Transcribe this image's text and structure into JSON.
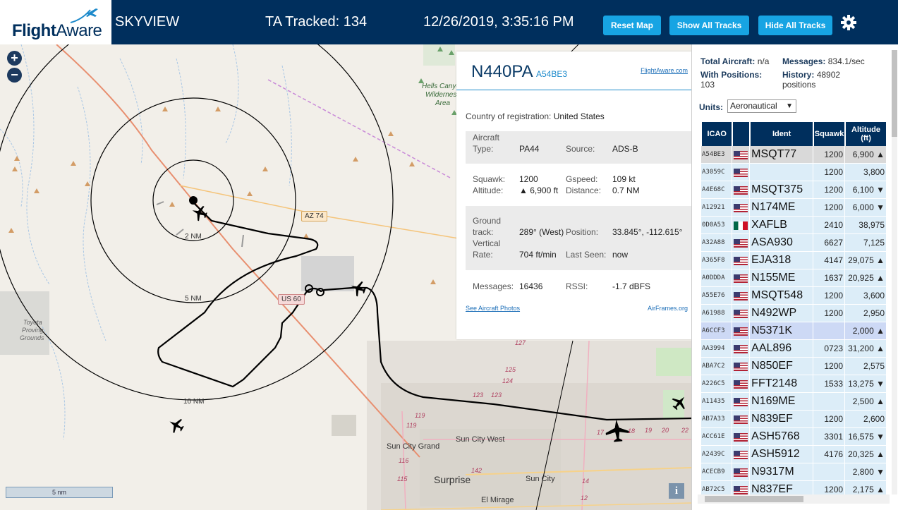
{
  "header": {
    "logo_text_a": "Flight",
    "logo_text_b": "Aware",
    "site_name": "SKYVIEW",
    "ta_tracked": "TA Tracked: 134",
    "clock": "12/26/2019, 3:35:16 PM",
    "buttons": {
      "reset_map": "Reset Map",
      "show_all": "Show All Tracks",
      "hide_all": "Hide All Tracks"
    },
    "settings_icon": "gear-icon",
    "bg_color": "#002f5d",
    "button_color": "#17a4e3"
  },
  "map": {
    "zoom_in": "+",
    "zoom_out": "−",
    "scale_label": "5 nm",
    "info": "i",
    "range_rings": [
      "2 NM",
      "5 NM",
      "10 NM"
    ],
    "road_labels": {
      "az74": "AZ 74",
      "us60": "US 60"
    },
    "places": {
      "hells_canyon_1": "Hells Canyon",
      "hells_canyon_2": "Wilderness",
      "hells_canyon_3": "Area",
      "toyota_1": "Toyota",
      "toyota_2": "Proving",
      "toyota_3": "Grounds",
      "sun_city_grand": "Sun City Grand",
      "sun_city_west": "Sun City West",
      "surprise": "Surprise",
      "sun_city": "Sun City",
      "el_mirage": "El Mirage"
    },
    "route_numbers": [
      "127",
      "125",
      "124",
      "123",
      "123",
      "119",
      "119",
      "116",
      "115",
      "142",
      "17",
      "18",
      "19",
      "20",
      "22",
      "14",
      "12"
    ]
  },
  "selected": {
    "ident": "N440PA",
    "hex": "A54BE3",
    "fa_link": "FlightAware.com",
    "country_label": "Country of registration:",
    "country": "United States",
    "aircraft_type_label_1": "Aircraft",
    "aircraft_type_label_2": "Type:",
    "aircraft_type": "PA44",
    "source_label": "Source:",
    "source": "ADS-B",
    "squawk_label": "Squawk:",
    "squawk": "1200",
    "gspeed_label": "Gspeed:",
    "gspeed": "109 kt",
    "altitude_label": "Altitude:",
    "altitude": "▲ 6,900 ft",
    "distance_label": "Distance:",
    "distance": "0.7 NM",
    "ground_label_1": "Ground",
    "ground_label_2": "track:",
    "ground_track": "289° (West)",
    "position_label": "Position:",
    "position": "33.845°, -112.615°",
    "vrate_label_1": "Vertical",
    "vrate_label_2": "Rate:",
    "vrate": "704 ft/min",
    "last_seen_label": "Last Seen:",
    "last_seen": "now",
    "messages_label": "Messages:",
    "messages": "16436",
    "rssi_label": "RSSI:",
    "rssi": "-1.7 dBFS",
    "photos_link": "See Aircraft Photos",
    "airframes_link": "AirFrames.org"
  },
  "sidebar": {
    "total_label": "Total Aircraft:",
    "total": "n/a",
    "messages_label": "Messages:",
    "messages": "834.1/sec",
    "with_pos_label": "With Positions:",
    "with_pos": "103",
    "history_label": "History:",
    "history": "48902",
    "history_unit": "positions",
    "units_label": "Units:",
    "units_value": "Aeronautical",
    "columns": [
      "ICAO",
      "",
      "Ident",
      "Squawk",
      "Altitude (ft)"
    ],
    "rows": [
      {
        "icao": "A54BE3",
        "flag": "us",
        "ident": "MSQT77",
        "squawk": "1200",
        "altitude": "6,900 ▲"
      },
      {
        "icao": "A3059C",
        "flag": "us",
        "ident": "",
        "squawk": "1200",
        "altitude": "3,800"
      },
      {
        "icao": "A4E68C",
        "flag": "us",
        "ident": "MSQT375",
        "squawk": "1200",
        "altitude": "6,100 ▼"
      },
      {
        "icao": "A12921",
        "flag": "us",
        "ident": "N174ME",
        "squawk": "1200",
        "altitude": "6,000 ▼"
      },
      {
        "icao": "0D0A53",
        "flag": "mx",
        "ident": "XAFLB",
        "squawk": "2410",
        "altitude": "38,975"
      },
      {
        "icao": "A32A88",
        "flag": "us",
        "ident": "ASA930",
        "squawk": "6627",
        "altitude": "7,125"
      },
      {
        "icao": "A365F8",
        "flag": "us",
        "ident": "EJA318",
        "squawk": "4147",
        "altitude": "29,075 ▲"
      },
      {
        "icao": "A0DDDA",
        "flag": "us",
        "ident": "N155ME",
        "squawk": "1637",
        "altitude": "20,925 ▲"
      },
      {
        "icao": "A55E76",
        "flag": "us",
        "ident": "MSQT548",
        "squawk": "1200",
        "altitude": "3,600"
      },
      {
        "icao": "A61988",
        "flag": "us",
        "ident": "N492WP",
        "squawk": "1200",
        "altitude": "2,950"
      },
      {
        "icao": "A6CCF3",
        "flag": "us",
        "ident": "N5371K",
        "squawk": "",
        "altitude": "2,000 ▲"
      },
      {
        "icao": "AA3994",
        "flag": "us",
        "ident": "AAL896",
        "squawk": "0723",
        "altitude": "31,200 ▲"
      },
      {
        "icao": "ABA7C2",
        "flag": "us",
        "ident": "N850EF",
        "squawk": "1200",
        "altitude": "2,575"
      },
      {
        "icao": "A226C5",
        "flag": "us",
        "ident": "FFT2148",
        "squawk": "1533",
        "altitude": "13,275 ▼"
      },
      {
        "icao": "A11435",
        "flag": "us",
        "ident": "N169ME",
        "squawk": "",
        "altitude": "2,500 ▲"
      },
      {
        "icao": "AB7A33",
        "flag": "us",
        "ident": "N839EF",
        "squawk": "1200",
        "altitude": "2,600"
      },
      {
        "icao": "ACC61E",
        "flag": "us",
        "ident": "ASH5768",
        "squawk": "3301",
        "altitude": "16,575 ▼"
      },
      {
        "icao": "A2439C",
        "flag": "us",
        "ident": "ASH5912",
        "squawk": "4176",
        "altitude": "20,325 ▲"
      },
      {
        "icao": "ACECB9",
        "flag": "us",
        "ident": "N9317M",
        "squawk": "",
        "altitude": "2,800 ▼"
      },
      {
        "icao": "AB72C5",
        "flag": "us",
        "ident": "N837EF",
        "squawk": "1200",
        "altitude": "2,175 ▲"
      }
    ]
  }
}
